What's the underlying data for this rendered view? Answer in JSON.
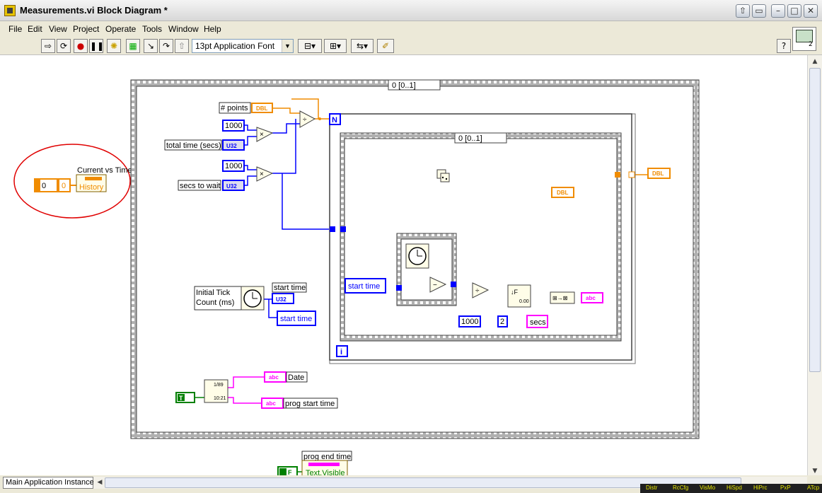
{
  "window": {
    "title": "Measurements.vi Block Diagram *",
    "buttons": [
      "restore",
      "tile",
      "minimize",
      "maximize",
      "close"
    ]
  },
  "menu": [
    "File",
    "Edit",
    "View",
    "Project",
    "Operate",
    "Tools",
    "Window",
    "Help"
  ],
  "toolbar": {
    "font_select": "13pt Application Font",
    "buttons": [
      "run-arrow",
      "run-continuous",
      "abort",
      "pause",
      "highlight-execution",
      "retain-wire-values",
      "step-into",
      "step-over",
      "step-out",
      "align-objects",
      "distribute-objects",
      "reorder",
      "cleanup-diagram"
    ],
    "help_icon": "?",
    "context_number": "2"
  },
  "diagram": {
    "outer_sequence_selector": "0 [0..1]",
    "inner_sequence_selector": "0 [0..1]",
    "history_node": {
      "index_a": "0",
      "index_b": "0",
      "label": "Current vs Time",
      "property": "History"
    },
    "points_label": "# points",
    "points_type": "DBL",
    "const_1000_a": "1000",
    "total_time_label": "total time (secs)",
    "total_time_type": "U32",
    "const_1000_b": "1000",
    "secs_wait_label": "secs to wait",
    "secs_wait_type": "U32",
    "for_loop_n": "N",
    "for_loop_i": "i",
    "dbl_indicator_inner": "DBL",
    "dbl_indicator_outer": "DBL",
    "tick_label": "Initial Tick Count (ms)",
    "start_time_label": "start time",
    "start_time_type": "U32",
    "start_time_local": "start time",
    "start_time_local_inner": "start time",
    "const_1000_c": "1000",
    "const_2": "2",
    "secs_const": "secs",
    "abc_indicator": "abc",
    "date_true": "T",
    "date_label": "Date",
    "date_type": "abc",
    "prog_start_label": "prog start time",
    "prog_start_type": "abc",
    "format_top": "1/89",
    "format_bottom": "10:21",
    "prog_end_label": "prog end time",
    "prog_end_false": "F",
    "text_visible": "Text.Visible"
  },
  "status": {
    "instance": "Main Application Instance",
    "toolkits": [
      "Distr",
      "RcCfg",
      "VisMo",
      "HiSpd",
      "HiPrc",
      "PxP",
      "ATcp"
    ]
  },
  "colors": {
    "wire_orange": "#f08c00",
    "wire_blue": "#0000ff",
    "wire_pink": "#ff00ff",
    "wire_green": "#008000",
    "annotation_red": "#e00000"
  }
}
